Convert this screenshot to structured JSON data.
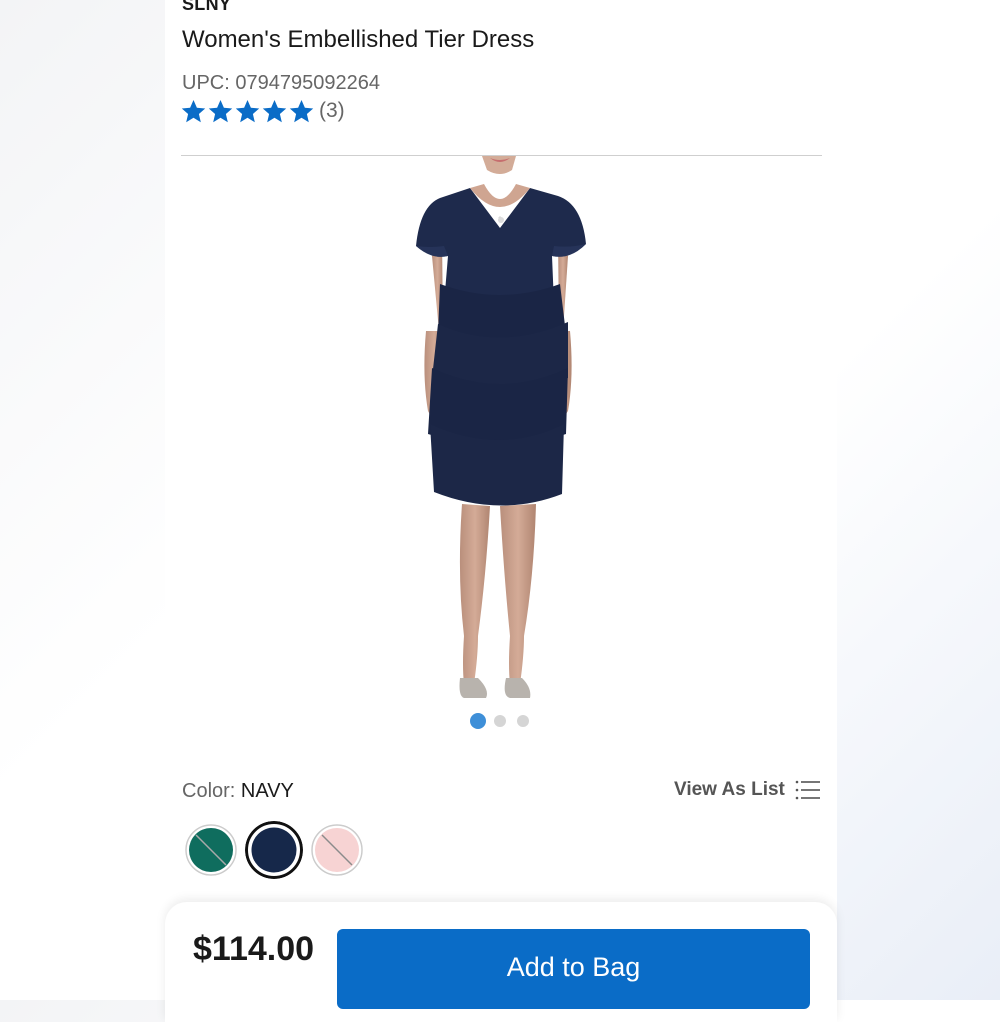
{
  "product": {
    "brand": "SLNY",
    "title": "Women's Embellished Tier Dress",
    "upc_label": "UPC:",
    "upc": "0794795092264",
    "rating": {
      "stars": 5,
      "max": 5,
      "count": "(3)"
    }
  },
  "gallery": {
    "image_icon": "dress-photo",
    "dots": 3,
    "active_dot": 0
  },
  "color": {
    "label": "Color:",
    "value": "NAVY",
    "view_as_list": "View As List",
    "swatches": [
      {
        "name": "teal",
        "color": "#0f6d5e",
        "unavailable": true
      },
      {
        "name": "navy",
        "color": "#16284a",
        "selected": true
      },
      {
        "name": "blush",
        "color": "#f7d3d3",
        "unavailable": true
      }
    ]
  },
  "purchase": {
    "price": "$114.00",
    "add_to_bag": "Add to Bag"
  },
  "colors": {
    "accent": "#0a6cc7",
    "dot_active": "#3e8fd8"
  }
}
